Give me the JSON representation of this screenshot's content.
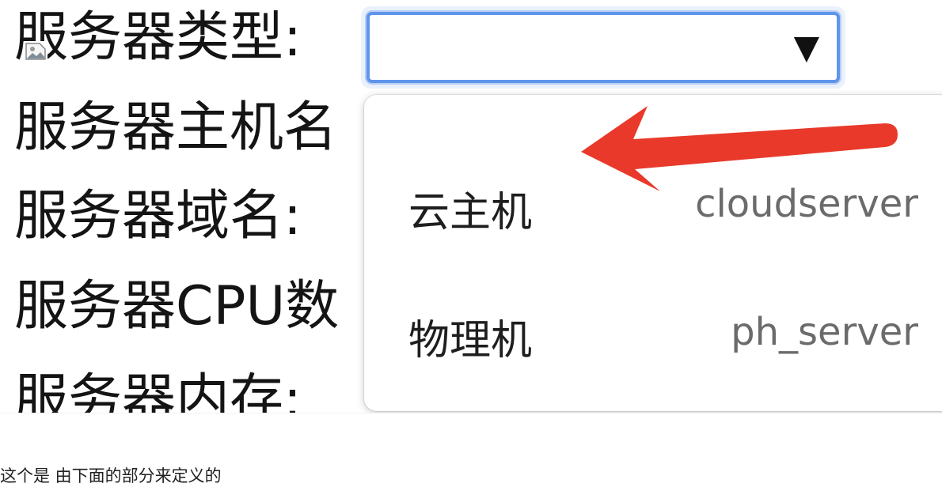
{
  "form": {
    "labels": [
      "服务器类型:",
      "服务器主机名",
      "服务器域名:",
      "服务器CPU数",
      "服务器内存:"
    ],
    "select": {
      "value": "",
      "caret": "▼"
    }
  },
  "dropdown": {
    "options": [
      {
        "label": "云主机",
        "value": "cloudserver"
      },
      {
        "label": "物理机",
        "value": "ph_server"
      }
    ]
  },
  "annotation": {
    "arrow_color": "#e8392a",
    "select_focus_color": "#5f95ea"
  },
  "caption": "这个是 由下面的部分来定义的"
}
